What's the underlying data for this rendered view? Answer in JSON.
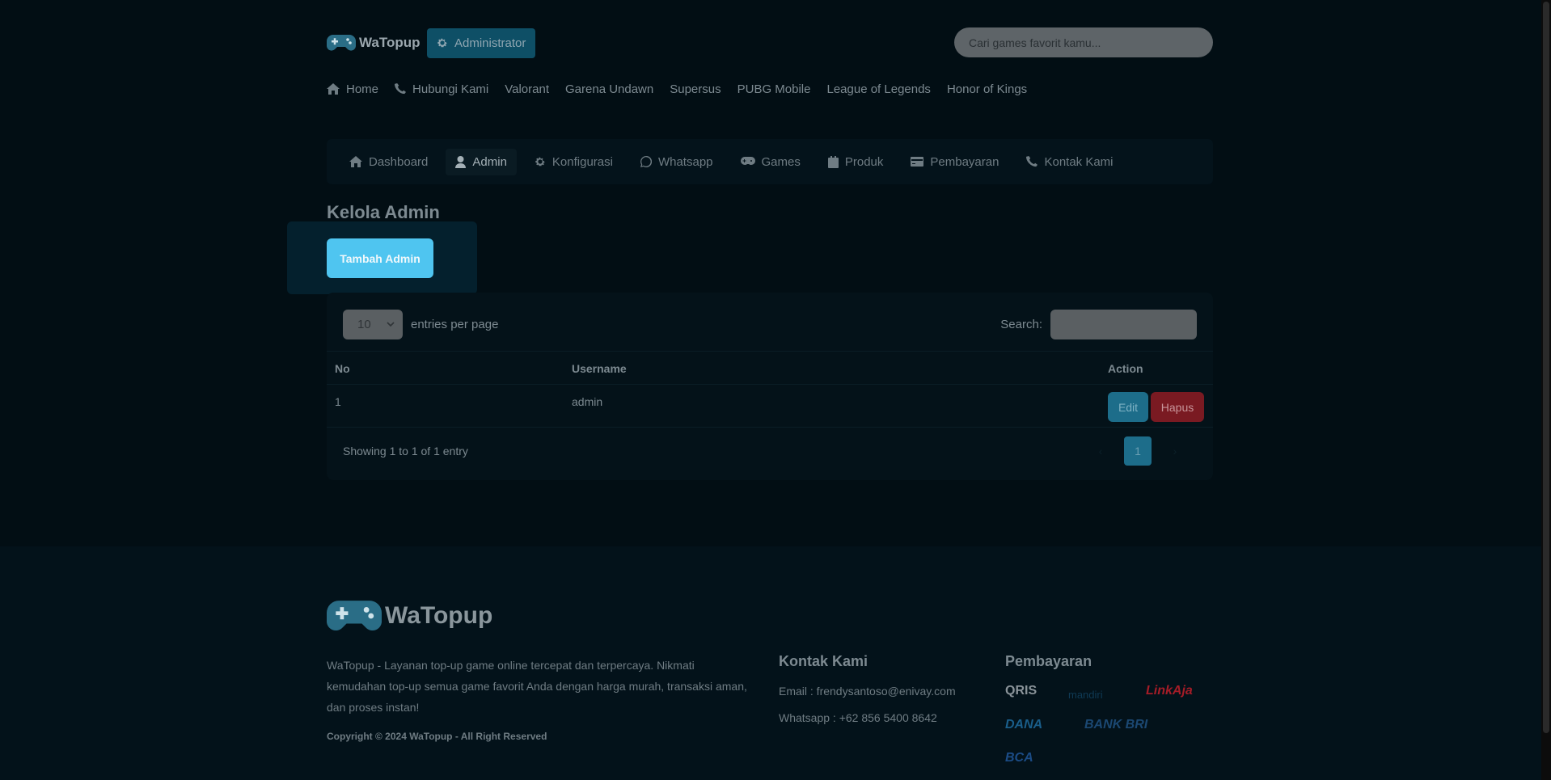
{
  "brand": {
    "name": "WaTopup"
  },
  "header": {
    "admin_button": "Administrator",
    "search_placeholder": "Cari games favorit kamu..."
  },
  "topnav": [
    {
      "label": "Home",
      "icon": "home-icon"
    },
    {
      "label": "Hubungi Kami",
      "icon": "phone-icon"
    },
    {
      "label": "Valorant"
    },
    {
      "label": "Garena Undawn"
    },
    {
      "label": "Supersus"
    },
    {
      "label": "PUBG Mobile"
    },
    {
      "label": "League of Legends"
    },
    {
      "label": "Honor of Kings"
    }
  ],
  "admin_tabs": [
    {
      "label": "Dashboard",
      "icon": "home-icon"
    },
    {
      "label": "Admin",
      "icon": "user-icon",
      "active": true
    },
    {
      "label": "Konfigurasi",
      "icon": "gear-icon"
    },
    {
      "label": "Whatsapp",
      "icon": "whatsapp-icon"
    },
    {
      "label": "Games",
      "icon": "gamepad-icon"
    },
    {
      "label": "Produk",
      "icon": "box-icon"
    },
    {
      "label": "Pembayaran",
      "icon": "card-icon"
    },
    {
      "label": "Kontak Kami",
      "icon": "phone-icon"
    }
  ],
  "page": {
    "title": "Kelola Admin",
    "add_button": "Tambah Admin"
  },
  "table": {
    "entries_value": "10",
    "entries_label": "entries per page",
    "search_label": "Search:",
    "columns": [
      "No",
      "Username",
      "Action"
    ],
    "rows": [
      {
        "no": "1",
        "username": "admin",
        "edit": "Edit",
        "delete": "Hapus"
      }
    ],
    "info": "Showing 1 to 1 of 1 entry",
    "prev": "‹",
    "current_page": "1",
    "next": "›"
  },
  "footer": {
    "about": "WaTopup - Layanan top-up game online tercepat dan terpercaya. Nikmati kemudahan top-up semua game favorit Anda dengan harga murah, transaksi aman, dan proses instan!",
    "copyright": "Copyright © 2024 WaTopup - All Right Reserved",
    "contact_heading": "Kontak Kami",
    "email": "Email : frendysantoso@enivay.com",
    "whatsapp": "Whatsapp : +62 856 5400 8642",
    "payment_heading": "Pembayaran",
    "payments": [
      "QRIS",
      "mandiri",
      "LinkAja",
      "DANA",
      "BANK BRI",
      "BCA"
    ]
  },
  "colors": {
    "background": "#020e14",
    "accent": "#4fc5f0",
    "danger": "#7a1a22"
  }
}
